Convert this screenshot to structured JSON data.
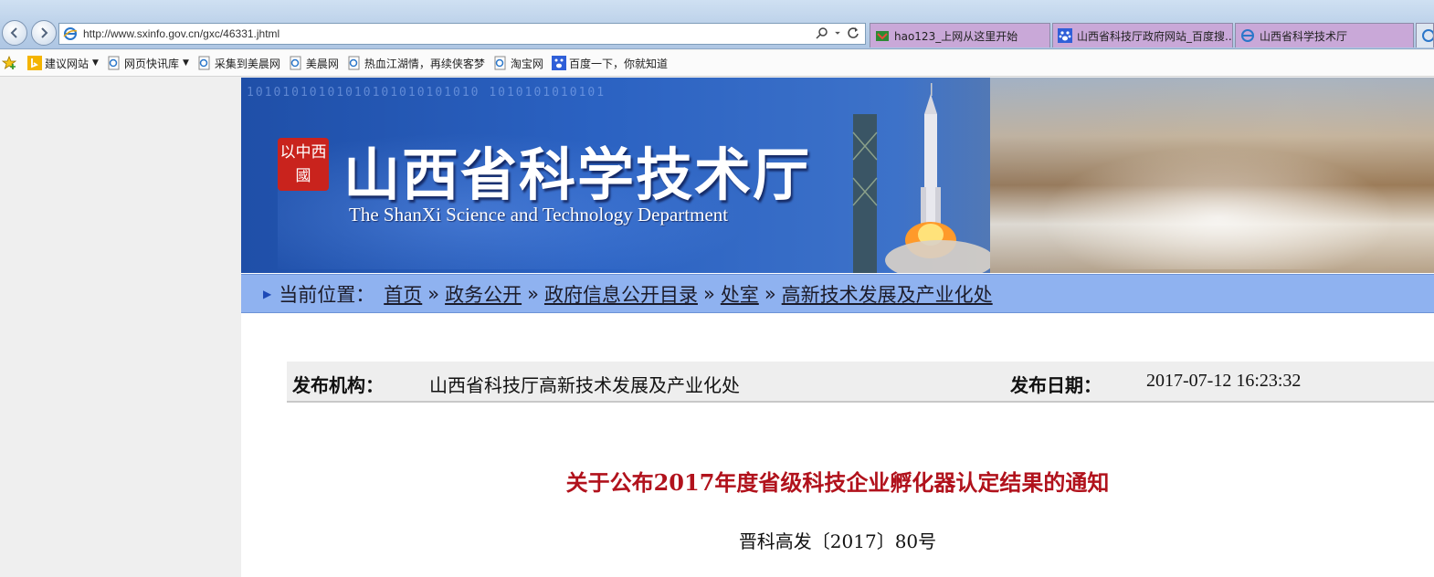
{
  "browser": {
    "url": "http://www.sxinfo.gov.cn/gxc/46331.jhtml",
    "tabs": [
      {
        "label": "hao123_上网从这里开始"
      },
      {
        "label": "山西省科技厅政府网站_百度搜..."
      },
      {
        "label": "山西省科学技术厅"
      },
      {
        "label": ""
      }
    ],
    "colors": {
      "active_tab": "#c9a8d8",
      "toolbar": "#b9cfe8"
    }
  },
  "favorites": [
    {
      "label": "建议网站",
      "icon": "bing-icon",
      "dropdown": true
    },
    {
      "label": "网页快讯库",
      "icon": "ie-page-icon",
      "dropdown": true
    },
    {
      "label": "采集到美晨网",
      "icon": "ie-page-icon"
    },
    {
      "label": "美晨网",
      "icon": "ie-page-icon"
    },
    {
      "label": "热血江湖情，再续侠客梦",
      "icon": "ie-page-icon"
    },
    {
      "label": "淘宝网",
      "icon": "ie-page-icon"
    },
    {
      "label": "百度一下，你就知道",
      "icon": "baidu-icon"
    }
  ],
  "banner": {
    "seal_text": "以中西國",
    "title": "山西省科学技术厅",
    "subtitle": "The ShanXi Science and Technology Department",
    "binary_text": "10101010101010101010101010  1010101010101"
  },
  "breadcrumb": {
    "prefix": "当前位置：",
    "items": [
      "首页",
      "政务公开",
      "政府信息公开目录",
      "处室",
      "高新技术发展及产业化处"
    ],
    "separator": "»"
  },
  "meta": {
    "publisher_label": "发布机构：",
    "publisher_value": "山西省科技厅高新技术发展及产业化处",
    "date_label": "发布日期：",
    "date_value": "2017-07-12 16:23:32"
  },
  "document": {
    "title": "关于公布2017年度省级科技企业孵化器认定结果的通知",
    "number": "晋科高发〔2017〕80号",
    "title_color": "#b1121c"
  }
}
